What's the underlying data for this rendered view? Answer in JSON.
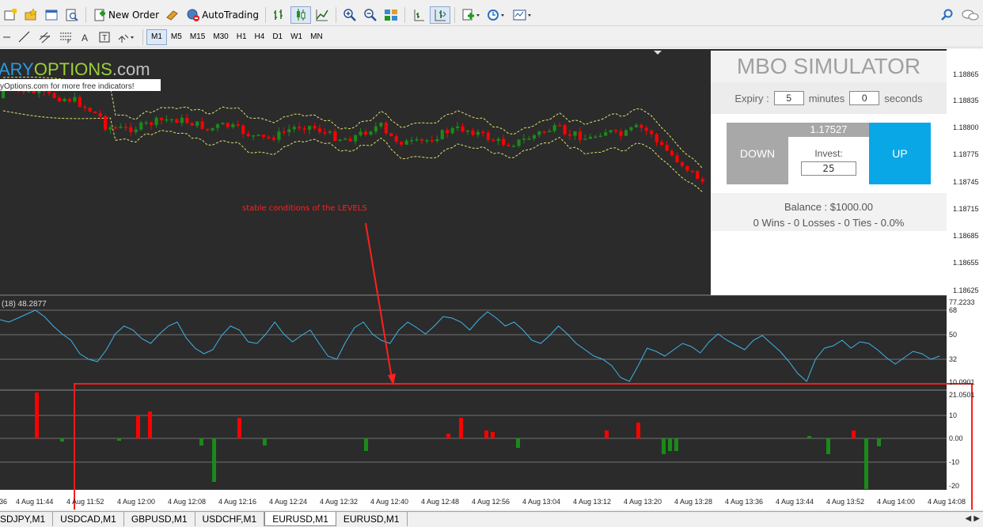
{
  "toolbar": {
    "new_order": "New Order",
    "autotrading": "AutoTrading",
    "timeframes": [
      "M1",
      "M5",
      "M15",
      "M30",
      "H1",
      "H4",
      "D1",
      "W1",
      "MN"
    ],
    "active_timeframe": "M1"
  },
  "chart": {
    "watermark_part1": "ARY",
    "watermark_part2": "OPTIONS",
    "watermark_part3": ".com",
    "banner": "yOptions.com for more free indicators!",
    "annotation": "stable conditions of the LEVELS",
    "indicator1_label": "(18) 48.2877",
    "price_axis": [
      "1.18865",
      "1.18835",
      "1.18800",
      "1.18775",
      "1.18745",
      "1.18715",
      "1.18685",
      "1.18655",
      "1.18625"
    ],
    "ind1_axis": [
      "77.2233",
      "68",
      "50",
      "32",
      "10.0901"
    ],
    "ind2_axis": [
      "21.0501",
      "10",
      "0.00",
      "-10",
      "-20"
    ],
    "time_axis": [
      "36",
      "4 Aug 11:44",
      "4 Aug 11:52",
      "4 Aug 12:00",
      "4 Aug 12:08",
      "4 Aug 12:16",
      "4 Aug 12:24",
      "4 Aug 12:32",
      "4 Aug 12:40",
      "4 Aug 12:48",
      "4 Aug 12:56",
      "4 Aug 13:04",
      "4 Aug 13:12",
      "4 Aug 13:20",
      "4 Aug 13:28",
      "4 Aug 13:36",
      "4 Aug 13:44",
      "4 Aug 13:52",
      "4 Aug 14:00",
      "4 Aug 14:08"
    ],
    "colors": {
      "background": "#2b2b2b",
      "bull": "#1a8a1a",
      "bear": "#ff0000",
      "band": "#e0e070",
      "line": "#3fb3e8",
      "annotation": "#ff2020"
    }
  },
  "mbo": {
    "title": "MBO SIMULATOR",
    "expiry_label": "Expiry :",
    "expiry_minutes": "5",
    "minutes_label": "minutes",
    "expiry_seconds": "0",
    "seconds_label": "seconds",
    "down_label": "DOWN",
    "up_label": "UP",
    "price": "1.17527",
    "invest_label": "Invest:",
    "invest_value": "25",
    "balance": "Balance : $1000.00",
    "record": "0 Wins - 0 Losses - 0 Ties - 0.0%"
  },
  "tabs": [
    "SDJPY,M1",
    "USDCAD,M1",
    "GBPUSD,M1",
    "USDCHF,M1",
    "EURUSD,M1",
    "EURUSD,M1"
  ],
  "active_tab_index": 4
}
